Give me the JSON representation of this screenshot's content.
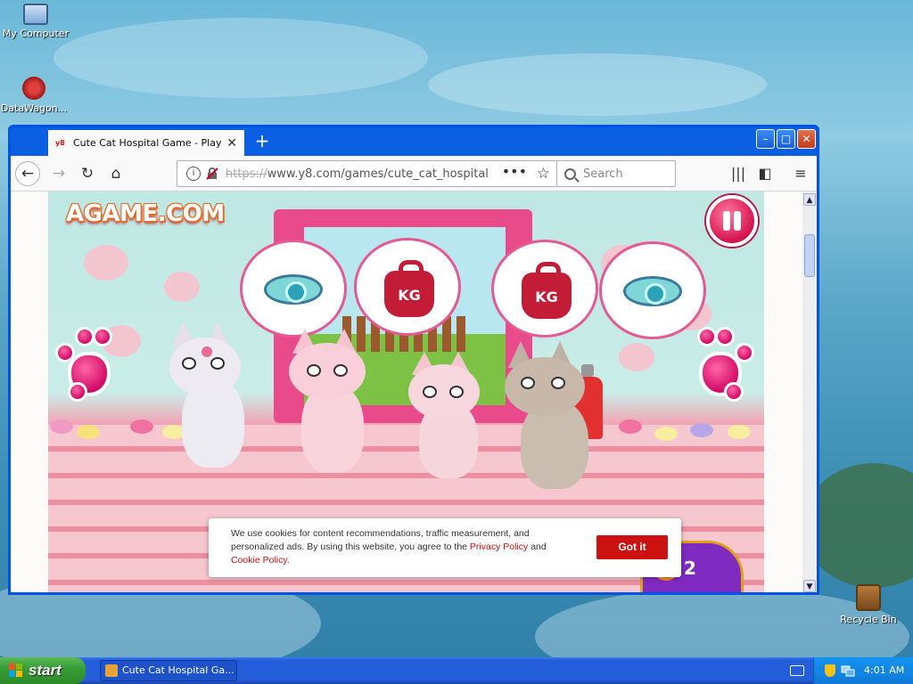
{
  "desktop": {
    "icons": [
      {
        "label": "My Computer"
      },
      {
        "label": "DataWagon..."
      },
      {
        "label": "Recycle Bin"
      }
    ]
  },
  "browser": {
    "tab_title": "Cute Cat Hospital Game - Play onli",
    "tab_favicon": "y8",
    "new_tab": "+",
    "url_protocol": "https://",
    "url_rest": "www.y8.com/games/cute_cat_hospital",
    "search_placeholder": "Search"
  },
  "game": {
    "logo": "AGAME.COM",
    "bubbles": [
      {
        "content": "eye-scan"
      },
      {
        "content": "weight",
        "label": "KG"
      },
      {
        "content": "weight",
        "label": "KG"
      },
      {
        "content": "eye-scan"
      }
    ],
    "coin_count": "2"
  },
  "cookie_banner": {
    "text_1": "We use cookies for content recommendations, traffic measurement, and personalized ads. By using this website, you agree to the ",
    "privacy_link": "Privacy Policy",
    "text_2": " and ",
    "cookie_link": "Cookie Policy",
    "text_3": ".",
    "button": "Got it"
  },
  "taskbar": {
    "start_label": "start",
    "window_item": "Cute Cat Hospital Ga...",
    "clock": "4:01 AM"
  },
  "colors": {
    "xp_blue": "#245edb",
    "start_green": "#379e35",
    "cookie_red": "#cc1111",
    "tab_active": "#f9f9fa"
  }
}
